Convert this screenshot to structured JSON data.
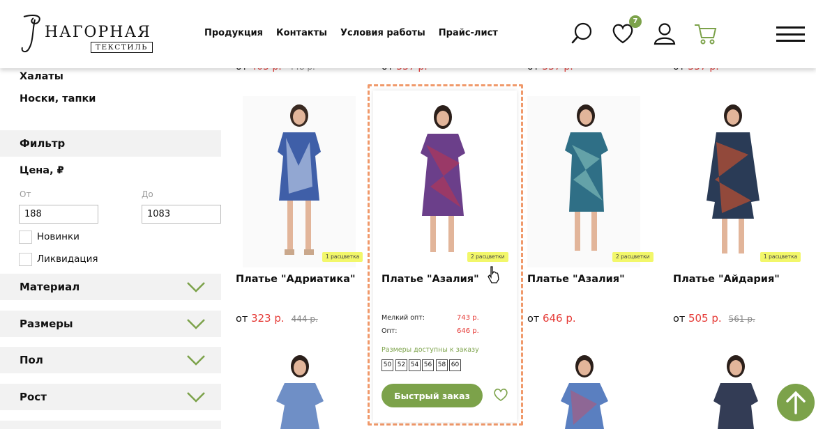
{
  "header": {
    "logo_title": "НАГОРНАЯ",
    "logo_sub": "ТЕКСТИЛЬ",
    "nav": [
      "Продукция",
      "Контакты",
      "Условия работы",
      "Прайс-лист"
    ],
    "favorites_count": "7"
  },
  "sidebar": {
    "links": [
      "Халаты",
      "Носки, тапки"
    ],
    "filter_title": "Фильтр",
    "price_title": "Цена, ₽",
    "from_label": "От",
    "to_label": "До",
    "price_from": "188",
    "price_to": "1083",
    "checkboxes": [
      "Новинки",
      "Ликвидация"
    ],
    "accordions": [
      "Материал",
      "Размеры",
      "Пол",
      "Рост"
    ]
  },
  "top_row_prices": [
    {
      "prefix": "от",
      "price": "403 р.",
      "old": "448 р."
    },
    {
      "prefix": "от",
      "price": "337 р.",
      "old": ""
    },
    {
      "prefix": "от",
      "price": "337 р.",
      "old": ""
    },
    {
      "prefix": "от",
      "price": "337 р.",
      "old": ""
    }
  ],
  "products": [
    {
      "name": "Платье \"Адриатика\"",
      "tag": "1 расцветка",
      "prefix": "от",
      "price": "323 р.",
      "old": "444 р."
    },
    {
      "name": "Платье \"Азалия\"",
      "tag": "2 расцветки",
      "prefix": "от",
      "price": "",
      "old": ""
    },
    {
      "name": "Платье \"Азалия\"",
      "tag": "2 расцветки",
      "prefix": "от",
      "price": "646 р.",
      "old": ""
    },
    {
      "name": "Платье \"Айдария\"",
      "tag": "1 расцветка",
      "prefix": "от",
      "price": "505 р.",
      "old": "561 р."
    }
  ],
  "hover_card": {
    "small_wholesale_label": "Мелкий опт:",
    "small_wholesale_price": "743 р.",
    "wholesale_label": "Опт:",
    "wholesale_price": "646 р.",
    "sizes_label": "Размеры доступны к заказу",
    "sizes": [
      "50",
      "52",
      "54",
      "56",
      "58",
      "60"
    ],
    "quick_order": "Быстрый заказ"
  },
  "colors": {
    "accent_green": "#7ca24a",
    "price_red": "#e53935",
    "dashed_orange": "#f0996a"
  }
}
